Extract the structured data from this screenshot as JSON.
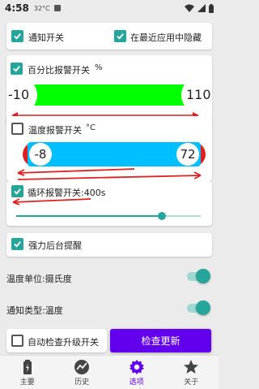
{
  "status_bar": {
    "time": "4:58",
    "temperature": "32°C"
  },
  "notify_card": {
    "notify_switch_label": "通知开关",
    "hide_recent_label": "在最近应用中隐藏"
  },
  "percent_card": {
    "label": "百分比报警开关",
    "unit": "%",
    "min_value": "-10",
    "max_value": "110"
  },
  "temp_card": {
    "label": "温度报警开关",
    "unit": "°C",
    "min_value": "-8",
    "max_value": "72"
  },
  "loop_card": {
    "label": "循环报警开关:400s",
    "slider_value_fraction": 0.79
  },
  "force_card": {
    "label": "强力后台提醒"
  },
  "settings": {
    "temp_unit_label": "温度单位:摄氏度",
    "notify_type_label": "通知类型:温度",
    "auto_check_label": "自动检查升级开关",
    "check_update_button": "检查更新"
  },
  "nav": {
    "main": "主要",
    "history": "历史",
    "options": "选项",
    "about": "关于"
  },
  "colors": {
    "accent": "#26a69a",
    "primary": "#6200ee",
    "green_bar": "#00ff00",
    "blue_bar": "#00bfff",
    "red": "#e02020"
  }
}
